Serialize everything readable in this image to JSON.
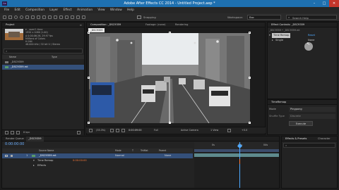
{
  "window": {
    "title": "Adobe After Effects CC 2014 - Untitled Project.aep *",
    "app_icon": "Ae",
    "controls": [
      "–",
      "□",
      "✕"
    ]
  },
  "menu": [
    "File",
    "Edit",
    "Composition",
    "Layer",
    "Effect",
    "Animation",
    "View",
    "Window",
    "Help"
  ],
  "toolbar": {
    "snapping_label": "Snapping",
    "workspace_label": "Workspace:",
    "workspace_value": "Bac",
    "search_placeholder": "Search Help"
  },
  "project": {
    "tab_label": "Project",
    "info_lines": [
      "▾ , used 1 time",
      "1920 x 1080 (1.00)",
      "Δ 0;00;06;26, 29.97 fps",
      "Millions of Colors",
      "H.264",
      "48.000 kHz / 32 bit U / Stereo"
    ],
    "search_placeholder": "",
    "col_name": "Name",
    "col_type": "Type",
    "items": [
      {
        "name": "_DSC9359",
        "selected": false
      },
      {
        "name": "_DSC9359.mt",
        "selected": true
      }
    ],
    "bpc": "8 bpc"
  },
  "composition": {
    "tab_label": "Composition: _DSC9359",
    "other_tabs": [
      "Footage: (none)",
      "Rendering"
    ],
    "comp_chip": "_DSC9359",
    "footer": [
      "(33.3%)",
      "0:00:09:00",
      "Full",
      "Active Camera",
      "1 View",
      "+0.0"
    ]
  },
  "effect_controls": {
    "tab_label": "Effect Controls: _DSC9359",
    "layer_path": "_DSC9359 • _DSC9359.mt",
    "effect_name": "Time Remap",
    "reset_label": "Reset",
    "param_label": "Single",
    "param_value": "None"
  },
  "time_remap": {
    "tab_label": "TimeRemap",
    "mode_label": "Mode",
    "mode_value": "Pingpong",
    "shuffle_label": "Shuffle Type",
    "shuffle_value": "Discrete",
    "execute_label": "Execute"
  },
  "timeline": {
    "tabs": [
      "Render Queue",
      "_DSC9359"
    ],
    "timecode": "0:00:00:00",
    "cols": [
      "Source Name",
      "Mode",
      "T",
      "TrkMat",
      "Parent"
    ],
    "layer": {
      "index": "1",
      "name": "_DSC9359.mt",
      "mode": "Normal",
      "parent": "None"
    },
    "sublines": [
      {
        "label": "Time Remap",
        "value": "0:00:00:00"
      },
      {
        "label": "Effects",
        "value": ""
      }
    ],
    "ruler": [
      "0s",
      "02s",
      "04s"
    ]
  },
  "effects_presets": {
    "tab_label": "Effects & Presets",
    "other_tab": "Character"
  },
  "colors": {
    "accent": "#4ea9ff",
    "titlebar": "#1e70b0",
    "layer_bar": "#5e8a8d",
    "playhead": "#4ea9ff",
    "warning": "#ff7b3a"
  }
}
